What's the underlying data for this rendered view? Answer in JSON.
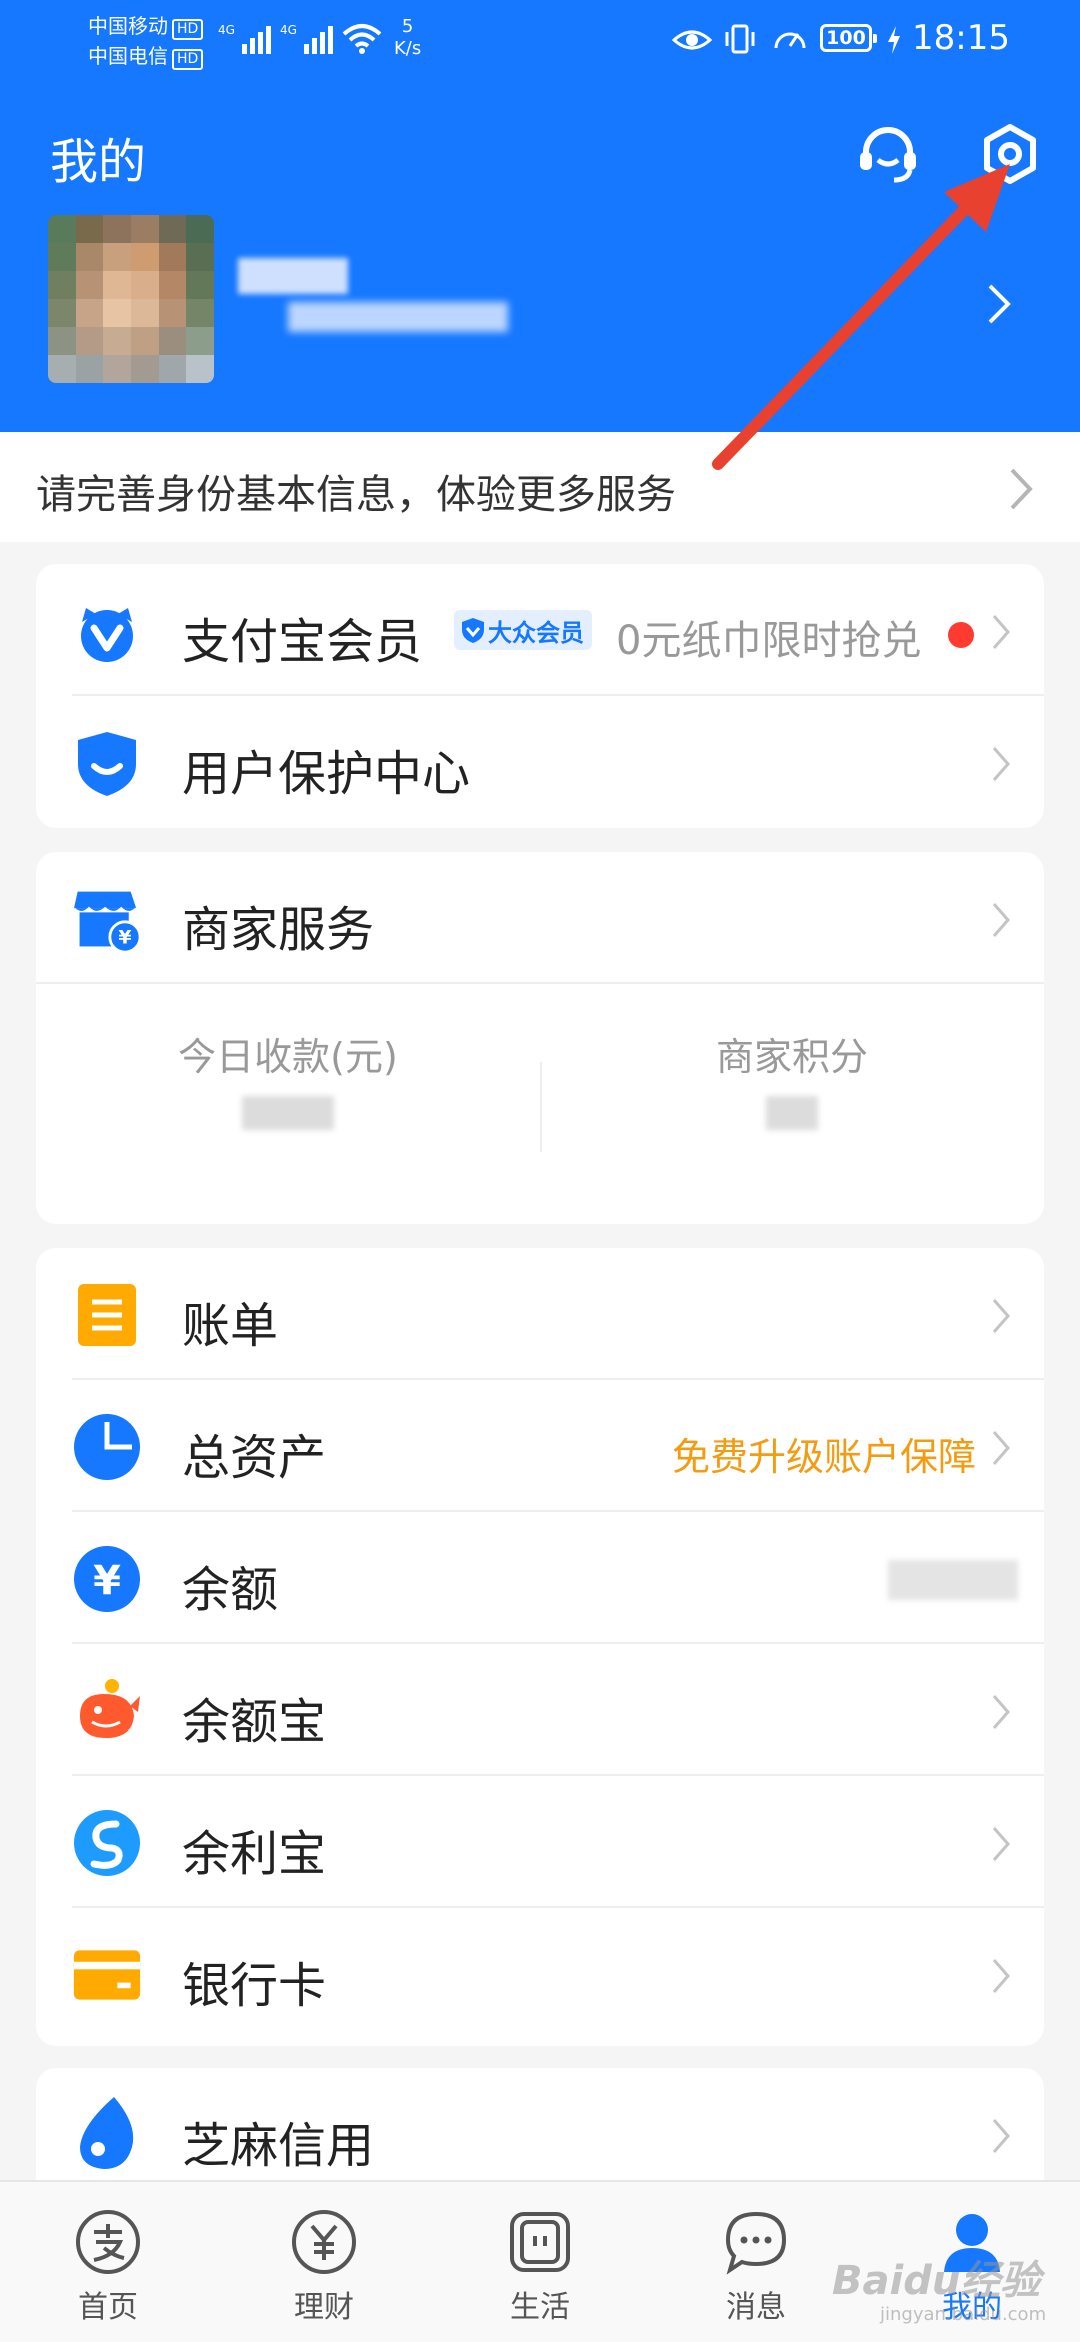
{
  "status_bar": {
    "carrier1": "中国移动",
    "carrier2": "中国电信",
    "hd": "HD",
    "net_speed_value": "5",
    "net_speed_unit": "K/s",
    "battery": "100",
    "time": "18:15"
  },
  "header": {
    "title": "我的"
  },
  "notice": {
    "text": "请完善身份基本信息，体验更多服务"
  },
  "card_member": {
    "rows": [
      {
        "label": "支付宝会员",
        "badge": "大众会员",
        "promo": "0元纸巾限时抢兑"
      },
      {
        "label": "用户保护中心"
      }
    ]
  },
  "card_merchant": {
    "title": "商家服务",
    "stats": [
      {
        "label": "今日收款(元)"
      },
      {
        "label": "商家积分"
      }
    ]
  },
  "card_assets": {
    "rows": [
      {
        "label": "账单"
      },
      {
        "label": "总资产",
        "hint": "免费升级账户保障"
      },
      {
        "label": "余额"
      },
      {
        "label": "余额宝"
      },
      {
        "label": "余利宝"
      },
      {
        "label": "银行卡"
      }
    ]
  },
  "card_credit": {
    "rows": [
      {
        "label": "芝麻信用"
      }
    ]
  },
  "tabbar": {
    "items": [
      {
        "label": "首页"
      },
      {
        "label": "理财"
      },
      {
        "label": "生活"
      },
      {
        "label": "消息"
      },
      {
        "label": "我的"
      }
    ]
  },
  "watermark": {
    "brand": "Baidu经验",
    "url": "jingyan.baidu.com"
  },
  "colors": {
    "brand_blue": "#1677ff",
    "annotation_red": "#e8412f",
    "hint_orange": "#f39c12"
  }
}
